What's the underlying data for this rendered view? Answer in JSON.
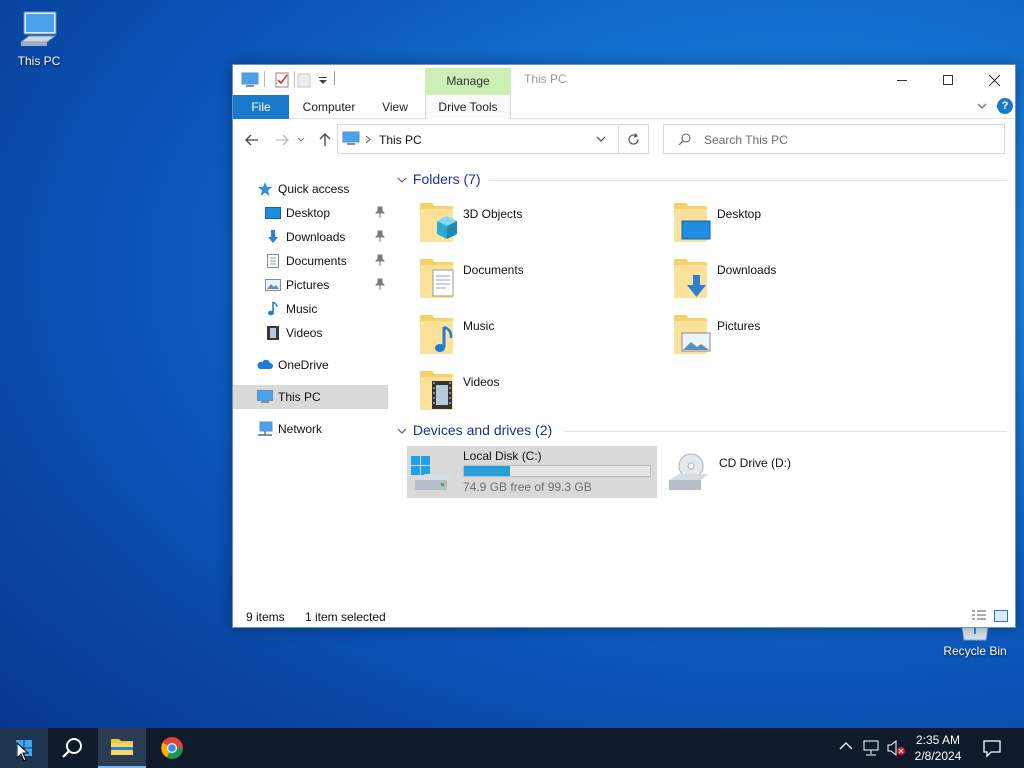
{
  "desktop": {
    "icons": [
      {
        "label": "This PC"
      },
      {
        "label": "Recycle Bin"
      }
    ]
  },
  "window": {
    "title": "This PC",
    "contextual_tab": "Manage",
    "ribbon_tabs": {
      "file": "File",
      "computer": "Computer",
      "view": "View",
      "drive_tools": "Drive Tools"
    },
    "address": {
      "path": "This PC"
    },
    "search": {
      "placeholder": "Search This PC"
    },
    "sidebar": {
      "items": [
        {
          "label": "Quick access",
          "icon": "star-icon"
        },
        {
          "label": "Desktop",
          "icon": "desktop-icon",
          "pinned": true
        },
        {
          "label": "Downloads",
          "icon": "download-icon",
          "pinned": true
        },
        {
          "label": "Documents",
          "icon": "document-icon",
          "pinned": true
        },
        {
          "label": "Pictures",
          "icon": "pictures-icon",
          "pinned": true
        },
        {
          "label": "Music",
          "icon": "music-icon"
        },
        {
          "label": "Videos",
          "icon": "videos-icon"
        },
        {
          "label": "OneDrive",
          "icon": "cloud-icon"
        },
        {
          "label": "This PC",
          "icon": "computer-icon",
          "selected": true
        },
        {
          "label": "Network",
          "icon": "network-icon"
        }
      ]
    },
    "folders_group": {
      "title": "Folders (7)",
      "items": [
        {
          "label": "3D Objects"
        },
        {
          "label": "Desktop"
        },
        {
          "label": "Documents"
        },
        {
          "label": "Downloads"
        },
        {
          "label": "Music"
        },
        {
          "label": "Pictures"
        },
        {
          "label": "Videos"
        }
      ]
    },
    "drives_group": {
      "title": "Devices and drives (2)",
      "drives": [
        {
          "label": "Local Disk (C:)",
          "free_text": "74.9 GB free of 99.3 GB",
          "used_fraction": 0.246,
          "selected": true
        },
        {
          "label": "CD Drive (D:)"
        }
      ]
    },
    "status": {
      "item_count": "9 items",
      "selected": "1 item selected"
    }
  },
  "taskbar": {
    "clock_time": "2:35 AM",
    "clock_date": "2/8/2024"
  },
  "colors": {
    "accent": "#1979ca",
    "selection": "#d9d9d9",
    "manage_tab": "#cdeeb6",
    "disk_bar": "#26a0da"
  }
}
